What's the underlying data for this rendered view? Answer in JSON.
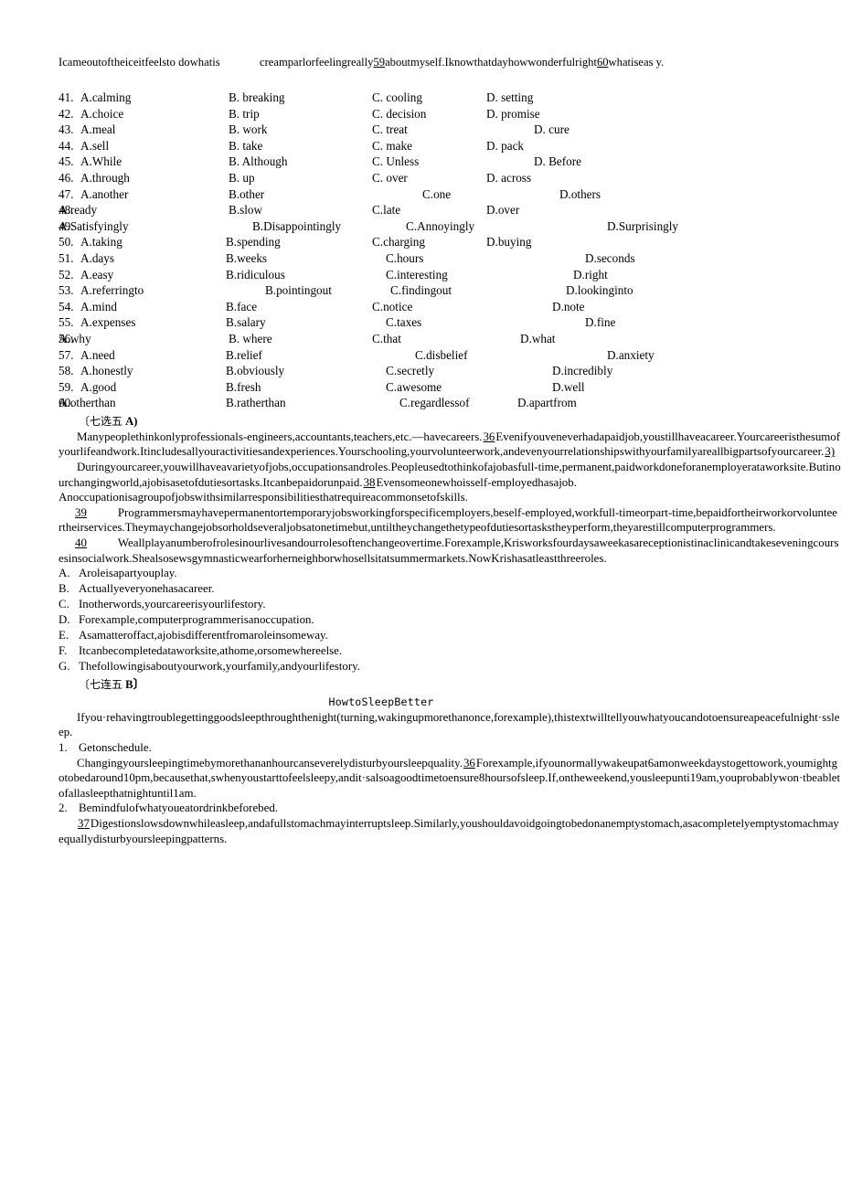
{
  "cloze": {
    "header_left": "Icameoutoftheiceitfeelsto dowhatis",
    "header_right_pre": "creamparlorfeelingreally",
    "header_right_blank1": "59",
    "header_right_mid": "aboutmyself.Iknowthatdayhowwonderfulright",
    "header_right_blank2": "60",
    "header_right_post": "whatiseas y.",
    "columns": [
      "A",
      "B",
      "C",
      "D"
    ],
    "rows": [
      {
        "num": "41.",
        "a": "A.calming",
        "b": "B.  breaking",
        "c": "C. cooling",
        "d": "D. setting"
      },
      {
        "num": "42.",
        "a": "A.choice",
        "b": "B.  trip",
        "c": "C. decision",
        "d": "D. promise"
      },
      {
        "num": "43.",
        "a": "A.meal",
        "b": "B.  work",
        "c": "C. treat",
        "d": "D. cure"
      },
      {
        "num": "44.",
        "a": "A.sell",
        "b": "B.  take",
        "c": "C. make",
        "d": "D. pack"
      },
      {
        "num": "45.",
        "a": "A.While",
        "b": "B.  Although",
        "c": "C. Unless",
        "d": "D. Before"
      },
      {
        "num": "46.",
        "a": "A.through",
        "b": "B.  up",
        "c": "C. over",
        "d": "D. across"
      },
      {
        "num": "47.",
        "a": "A.another",
        "b": "B.other",
        "c": "C.one",
        "d": "D.others"
      },
      {
        "num": "48.",
        "a": "A.ready",
        "b": "B.slow",
        "c": "C.late",
        "d": "D.over"
      },
      {
        "num": "49.",
        "a": "A.Satisfyingly",
        "b": "B.Disappointingly",
        "c": "C.Annoyingly",
        "d": "D.Surprisingly"
      },
      {
        "num": "50.",
        "a": "A.taking",
        "b": "B.spending",
        "c": "C.charging",
        "d": "D.buying"
      },
      {
        "num": "51.",
        "a": "A.days",
        "b": "B.weeks",
        "c": "C.hours",
        "d": "D.seconds"
      },
      {
        "num": "52.",
        "a": "A.easy",
        "b": "B.ridiculous",
        "c": "C.interesting",
        "d": "D.right"
      },
      {
        "num": "53.",
        "a": "A.referringto",
        "b": "B.pointingout",
        "c": "C.findingout",
        "d": "D.lookinginto"
      },
      {
        "num": "54.",
        "a": "A.mind",
        "b": "B.face",
        "c": "C.notice",
        "d": "D.note"
      },
      {
        "num": "55.",
        "a": "A.expenses",
        "b": "B.salary",
        "c": "C.taxes",
        "d": "D.fine"
      },
      {
        "num": "56.",
        "a": "A.why",
        "b": "B.  where",
        "c": "C.that",
        "d": "D.what"
      },
      {
        "num": "57.",
        "a": "A.need",
        "b": "B.relief",
        "c": "C.disbelief",
        "d": "D.anxiety"
      },
      {
        "num": "58.",
        "a": "A.honestly",
        "b": "B.obviously",
        "c": "C.secretly",
        "d": "D.incredibly"
      },
      {
        "num": "59.",
        "a": "A.good",
        "b": "B.fresh",
        "c": "C.awesome",
        "d": "D.well"
      },
      {
        "num": "60.",
        "a": "A.otherthan",
        "b": "B.ratherthan",
        "c": "C.regardlessof",
        "d": "D.apartfrom"
      }
    ]
  },
  "section_a": {
    "heading_cn": "〔七选五",
    "heading_label": "A)",
    "p1_a": "Manypeoplethinkonlyprofessionals-engineers,accountants,teachers,etc.—havecareers.",
    "p1_gap": "36",
    "p1_b": "Evenifyouveneverhadapaidjob,youstillhaveacareer.Yourcareeristhesumofyourlifeandwork.Itincludesallyouractivitiesandexperiences.Yourschooling,yourvolunteerwork,andevenyourrelationshipswithyourfamilyareallbigpartsofyourcareer.",
    "p1_gap2": "3)",
    "p2_a": "Duringyourcareer,youwillhaveavarietyofjobs,occupationsandroles.Peopleusedtothinkofajobasfull-time,permanent,paidworkdoneforanemployerataworksite.Butinourchangingworld,ajobisasetofdutiesortasks.Itcanbepaidorunpaid.",
    "p2_gap": "38",
    "p2_b": "Evensomeonewhoisself-employedhasajob.",
    "p3": "Anoccupationisagroupofjobswithsimilarresponsibilitiesthatrequireacommonsetofskills.",
    "p4_gap": "39",
    "p4": "Programmersmayhavepermanentortemporaryjobsworkingforspecificemployers,beself-employed,workfull-timeorpart-time,bepaidfortheirworkorvolunteertheirservices.Theymaychangejobsorholdseveraljobsatonetimebut,untiltheychangethetypeofdutiesortaskstheyperform,theyarestillcomputerprogrammers.",
    "p5_gap": "40",
    "p5": "Weallplayanumberofrolesinourlivesandourrolesoftenchangeovertime.Forexample,Krisworksfourdaysaweekasareceptionistinaclinicandtakeseveningcoursesinsocialwork.Shealsosewsgymnasticwearforherneighborwhosellsitatsummermarkets.NowKrishasatleastthreeroles.",
    "choices": [
      {
        "label": "A.",
        "text": "Aroleisapartyouplay."
      },
      {
        "label": "B.",
        "text": "Actuallyeveryonehasacareer."
      },
      {
        "label": "C.",
        "text": "Inotherwords,yourcareerisyourlifestory."
      },
      {
        "label": "D.",
        "text": "Forexample,computerprogrammerisanoccupation."
      },
      {
        "label": "E.",
        "text": "Asamatteroffact,ajobisdifferentfromaroleinsomeway."
      },
      {
        "label": "F.",
        "text": "Itcanbecompletedataworksite,athome,orsomewhereelse."
      },
      {
        "label": "G.",
        "text": "Thefollowingisaboutyourwork,yourfamily,andyourlifestory."
      }
    ]
  },
  "section_b": {
    "heading_cn": "〔七连五",
    "heading_label": "B〕",
    "title": "HowtoSleepBetter",
    "intro": "Ifyou·rehavingtroublegettinggoodsleepthroughthenight(turning,wakingupmorethanonce,forexample),thistextwilltellyouwhatyoucandotoensureapeacefulnight·ssleep.",
    "items": [
      {
        "label": "1.",
        "heading": "Getonschedule.",
        "body_a": "Changingyoursleepingtimebymorethananhourcanseverelydisturbyoursleepquality.",
        "gap": "36",
        "body_b": "Forexample,ifyounormallywakeupat6amonweekdaystogettowork,youmightgotobedaround10pm,becausethat,swhenyoustarttofeelsleepy,andit·salsoagoodtimetoensure8hoursofsleep.If,ontheweekend,yousleepunti19am,youprobablywon·tbeabletofallasleepthatnightuntil1am."
      },
      {
        "label": "2.",
        "heading": "Bemindfulofwhatyoueatordrinkbeforebed.",
        "gap": "37",
        "body_b": "Digestionslowsdownwhileasleep,andafullstomachmayinterruptsleep.Similarly,youshouldavoidgoingtobedonanemptystomach,asacompletelyemptystomachmayequallydisturbyoursleepingpatterns."
      }
    ]
  }
}
